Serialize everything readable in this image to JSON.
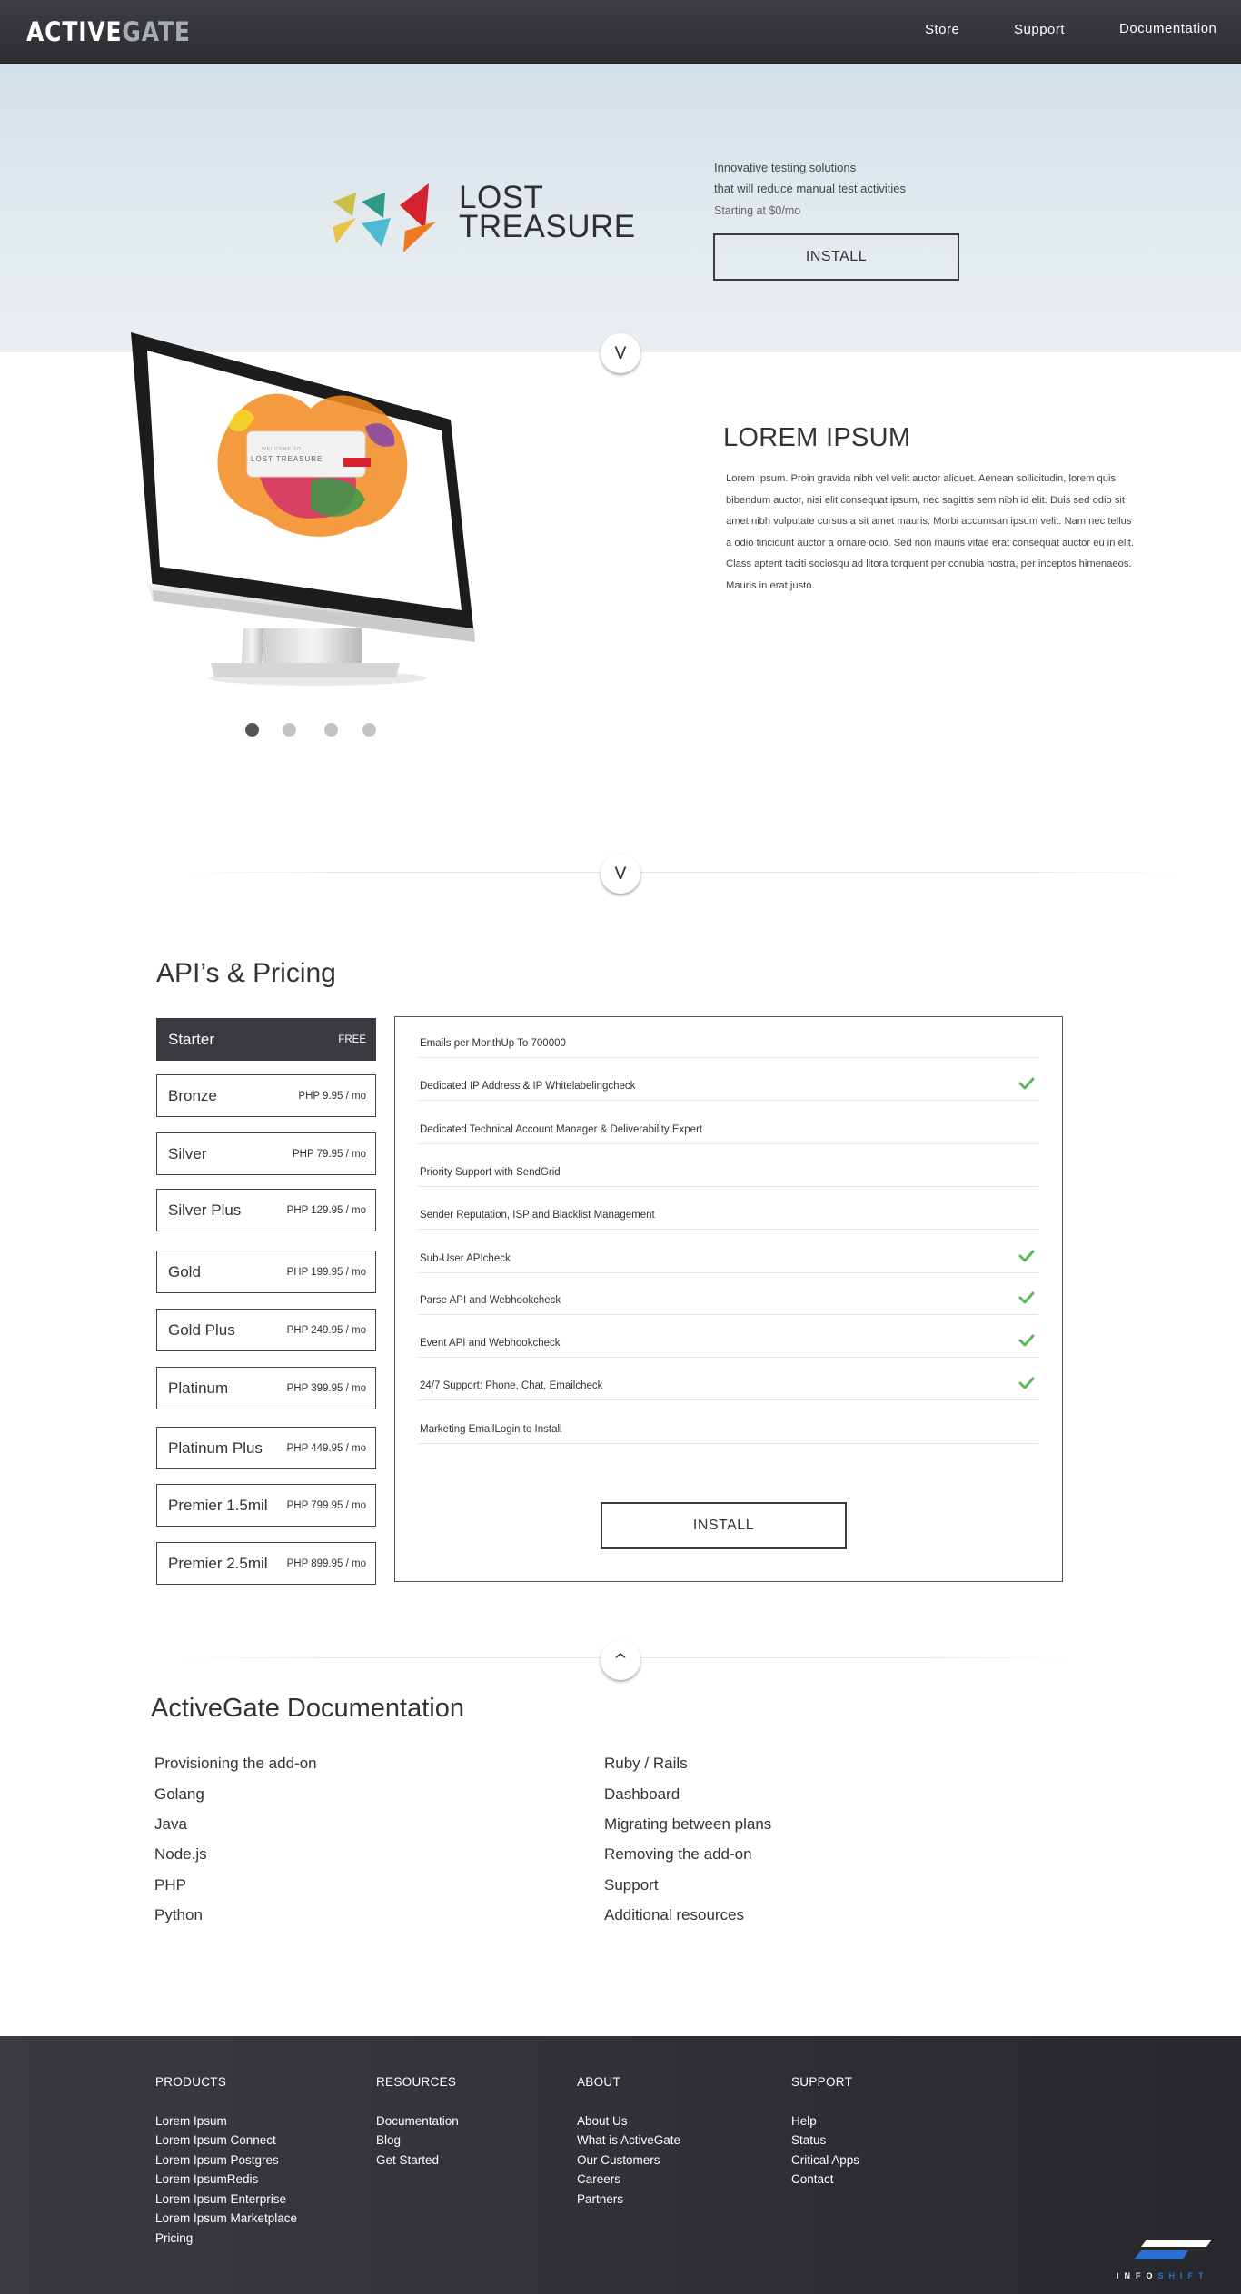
{
  "colors": {
    "nav_bg": "#333437",
    "hero_bg": "#e3eaee",
    "footer_bg": "#303134",
    "check_green": "#5cb85c",
    "active_plan_bg": "#3a3b3e"
  },
  "header": {
    "logo_active": "ACTIVE",
    "logo_gate": "GATE",
    "nav": [
      "Store",
      "Support",
      "Documentation"
    ]
  },
  "hero": {
    "brand_line1": "LOST",
    "brand_line2": "TREASURE",
    "tagline_line1": "Innovative testing solutions",
    "tagline_line2": "that will reduce manual test activities",
    "price_note": "Starting at $0/mo",
    "install_label": "INSTALL",
    "toggle_label": "V"
  },
  "showcase": {
    "screen_small_text": "WELCOME TO",
    "screen_brand": "LOST TREASURE",
    "title": "LOREM IPSUM",
    "body": "Lorem Ipsum. Proin gravida nibh vel velit auctor aliquet. Aenean sollicitudin, lorem quis bibendum auctor, nisi elit consequat ipsum, nec sagittis sem nibh id elit. Duis sed odio sit amet nibh vulputate cursus a sit amet mauris. Morbi accumsan ipsum velit. Nam nec tellus a odio tincidunt auctor a ornare odio. Sed non  mauris vitae erat consequat auctor eu in elit. Class aptent taciti sociosqu ad litora torquent per conubia nostra, per inceptos himenaeos. Mauris in erat justo.",
    "carousel_active_index": 0,
    "toggle_label": "V"
  },
  "pricing": {
    "title": "API’s & Pricing",
    "plans": [
      {
        "name": "Starter",
        "price": "FREE"
      },
      {
        "name": "Bronze",
        "price": "PHP 9.95 / mo"
      },
      {
        "name": "Silver",
        "price": "PHP 79.95 / mo"
      },
      {
        "name": "Silver Plus",
        "price": "PHP 129.95 / mo"
      },
      {
        "name": "Gold",
        "price": "PHP 199.95 / mo"
      },
      {
        "name": "Gold  Plus",
        "price": "PHP 249.95 / mo"
      },
      {
        "name": "Platinum",
        "price": "PHP 399.95 / mo"
      },
      {
        "name": "Platinum Plus",
        "price": "PHP 449.95 / mo"
      },
      {
        "name": "Premier 1.5mil",
        "price": "PHP 799.95 / mo"
      },
      {
        "name": "Premier 2.5mil",
        "price": "PHP 899.95 / mo"
      }
    ],
    "features": [
      {
        "text": "Emails per MonthUp To 700000",
        "check": false
      },
      {
        "text": "Dedicated IP Address & IP Whitelabelingcheck",
        "check": true
      },
      {
        "text": "Dedicated Technical Account Manager & Deliverability Expert",
        "check": false
      },
      {
        "text": "Priority Support with SendGrid",
        "check": false
      },
      {
        "text": "Sender Reputation, ISP and Blacklist Management",
        "check": false
      },
      {
        "text": "Sub-User APIcheck",
        "check": true
      },
      {
        "text": "Parse API and Webhookcheck",
        "check": true
      },
      {
        "text": "Event API and Webhookcheck",
        "check": true
      },
      {
        "text": "24/7 Support: Phone, Chat, Emailcheck",
        "check": true
      },
      {
        "text": "Marketing EmailLogin to Install",
        "check": false
      }
    ],
    "install_label": "INSTALL",
    "toggle_label": "^"
  },
  "docs": {
    "title": "ActiveGate Documentation",
    "left": [
      "Provisioning the add-on",
      "Golang",
      "Java",
      "Node.js",
      "PHP",
      "Python"
    ],
    "right": [
      "Ruby / Rails",
      "Dashboard",
      "Migrating between plans",
      "Removing the add-on",
      "Support",
      "Additional resources"
    ]
  },
  "footer": {
    "columns": [
      {
        "heading": "PRODUCTS",
        "links": [
          "Lorem Ipsum",
          "Lorem Ipsum Connect",
          "Lorem Ipsum Postgres",
          "Lorem IpsumRedis",
          "Lorem Ipsum Enterprise",
          "Lorem Ipsum Marketplace",
          "Pricing"
        ]
      },
      {
        "heading": "RESOURCES",
        "links": [
          "Documentation",
          "Blog",
          "Get Started"
        ]
      },
      {
        "heading": "ABOUT",
        "links": [
          "About Us",
          "What is ActiveGate",
          "Our Customers",
          "Careers",
          "Partners"
        ]
      },
      {
        "heading": "SUPPORT",
        "links": [
          "Help",
          "Status",
          "Critical Apps",
          "Contact"
        ]
      }
    ],
    "credit_info": "INFO",
    "credit_shift": "SHIFT"
  }
}
